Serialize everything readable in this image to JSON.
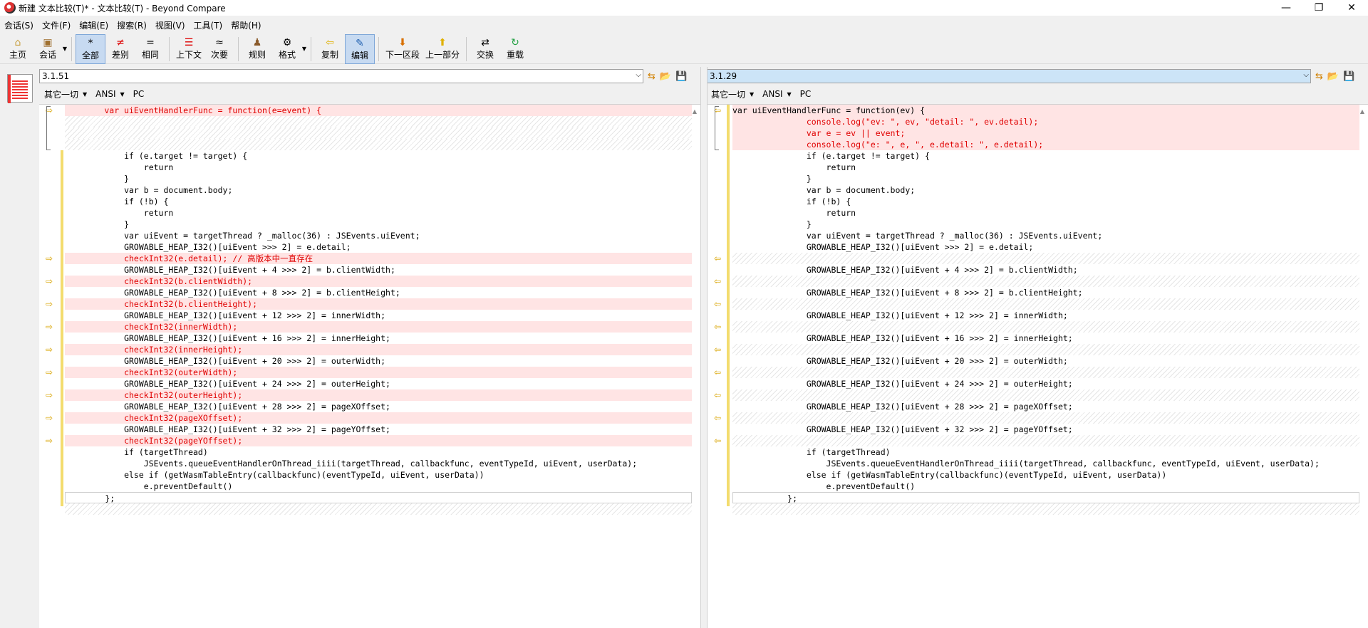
{
  "window": {
    "title": "新建 文本比较(T)* - 文本比较(T) - Beyond Compare",
    "controls": [
      "—",
      "❐",
      "✕"
    ]
  },
  "menu": [
    "会话(S)",
    "文件(F)",
    "编辑(E)",
    "搜索(R)",
    "视图(V)",
    "工具(T)",
    "帮助(H)"
  ],
  "toolbar": [
    {
      "label": "主页",
      "icon": "⌂"
    },
    {
      "label": "会话",
      "icon": "▣"
    },
    {
      "label": "全部",
      "icon": "*"
    },
    {
      "label": "差别",
      "icon": "≠"
    },
    {
      "label": "相同",
      "icon": "="
    },
    {
      "label": "上下文",
      "icon": "☰"
    },
    {
      "label": "次要",
      "icon": "≈"
    },
    {
      "label": "规则",
      "icon": "♟"
    },
    {
      "label": "格式",
      "icon": "⚙"
    },
    {
      "label": "复制",
      "icon": "⇦"
    },
    {
      "label": "编辑",
      "icon": "✎"
    },
    {
      "label": "下一区段",
      "icon": "⬇"
    },
    {
      "label": "上一部分",
      "icon": "⬆"
    },
    {
      "label": "交换",
      "icon": "⇄"
    },
    {
      "label": "重载",
      "icon": "↻"
    }
  ],
  "left": {
    "path": "3.1.51",
    "info": [
      "其它一切",
      "ANSI",
      "PC"
    ],
    "lines": [
      {
        "text": "        var uiEventHandlerFunc = function(e=event) {",
        "type": "diff",
        "mark": "⇨"
      },
      {
        "text": "",
        "type": "hatch"
      },
      {
        "text": "",
        "type": "hatch"
      },
      {
        "text": "",
        "type": "hatch"
      },
      {
        "text": "            if (e.target != target) {",
        "type": "same"
      },
      {
        "text": "                return",
        "type": "same"
      },
      {
        "text": "            }",
        "type": "same"
      },
      {
        "text": "            var b = document.body;",
        "type": "same"
      },
      {
        "text": "            if (!b) {",
        "type": "same"
      },
      {
        "text": "                return",
        "type": "same"
      },
      {
        "text": "            }",
        "type": "same"
      },
      {
        "text": "            var uiEvent = targetThread ? _malloc(36) : JSEvents.uiEvent;",
        "type": "same"
      },
      {
        "text": "            GROWABLE_HEAP_I32()[uiEvent >>> 2] = e.detail;",
        "type": "same"
      },
      {
        "text": "            checkInt32(e.detail); // 高版本中一直存在",
        "type": "diff",
        "mark": "⇨"
      },
      {
        "text": "            GROWABLE_HEAP_I32()[uiEvent + 4 >>> 2] = b.clientWidth;",
        "type": "same"
      },
      {
        "text": "            checkInt32(b.clientWidth);",
        "type": "diff",
        "mark": "⇨"
      },
      {
        "text": "            GROWABLE_HEAP_I32()[uiEvent + 8 >>> 2] = b.clientHeight;",
        "type": "same"
      },
      {
        "text": "            checkInt32(b.clientHeight);",
        "type": "diff",
        "mark": "⇨"
      },
      {
        "text": "            GROWABLE_HEAP_I32()[uiEvent + 12 >>> 2] = innerWidth;",
        "type": "same"
      },
      {
        "text": "            checkInt32(innerWidth);",
        "type": "diff",
        "mark": "⇨"
      },
      {
        "text": "            GROWABLE_HEAP_I32()[uiEvent + 16 >>> 2] = innerHeight;",
        "type": "same"
      },
      {
        "text": "            checkInt32(innerHeight);",
        "type": "diff",
        "mark": "⇨"
      },
      {
        "text": "            GROWABLE_HEAP_I32()[uiEvent + 20 >>> 2] = outerWidth;",
        "type": "same"
      },
      {
        "text": "            checkInt32(outerWidth);",
        "type": "diff",
        "mark": "⇨"
      },
      {
        "text": "            GROWABLE_HEAP_I32()[uiEvent + 24 >>> 2] = outerHeight;",
        "type": "same"
      },
      {
        "text": "            checkInt32(outerHeight);",
        "type": "diff",
        "mark": "⇨"
      },
      {
        "text": "            GROWABLE_HEAP_I32()[uiEvent + 28 >>> 2] = pageXOffset;",
        "type": "same"
      },
      {
        "text": "            checkInt32(pageXOffset);",
        "type": "diff",
        "mark": "⇨"
      },
      {
        "text": "            GROWABLE_HEAP_I32()[uiEvent + 32 >>> 2] = pageYOffset;",
        "type": "same"
      },
      {
        "text": "            checkInt32(pageYOffset);",
        "type": "diff",
        "mark": "⇨"
      },
      {
        "text": "            if (targetThread)",
        "type": "same"
      },
      {
        "text": "                JSEvents.queueEventHandlerOnThread_iiii(targetThread, callbackfunc, eventTypeId, uiEvent, userData);",
        "type": "same"
      },
      {
        "text": "            else if (getWasmTableEntry(callbackfunc)(eventTypeId, uiEvent, userData))",
        "type": "same"
      },
      {
        "text": "                e.preventDefault()",
        "type": "same"
      },
      {
        "text": "        };",
        "type": "end"
      },
      {
        "text": "",
        "type": "hatch"
      }
    ]
  },
  "right": {
    "path": "3.1.29",
    "info": [
      "其它一切",
      "ANSI",
      "PC"
    ],
    "lines": [
      {
        "text": "var uiEventHandlerFunc = function(ev) {",
        "type": "diff-plain",
        "mark": "⇦"
      },
      {
        "text": "               console.log(\"ev: \", ev, \"detail: \", ev.detail);",
        "type": "diff"
      },
      {
        "text": "               var e = ev || event;",
        "type": "diff"
      },
      {
        "text": "               console.log(\"e: \", e, \", e.detail: \", e.detail);",
        "type": "diff"
      },
      {
        "text": "               if (e.target != target) {",
        "type": "same"
      },
      {
        "text": "                   return",
        "type": "same"
      },
      {
        "text": "               }",
        "type": "same"
      },
      {
        "text": "               var b = document.body;",
        "type": "same"
      },
      {
        "text": "               if (!b) {",
        "type": "same"
      },
      {
        "text": "                   return",
        "type": "same"
      },
      {
        "text": "               }",
        "type": "same"
      },
      {
        "text": "               var uiEvent = targetThread ? _malloc(36) : JSEvents.uiEvent;",
        "type": "same"
      },
      {
        "text": "               GROWABLE_HEAP_I32()[uiEvent >>> 2] = e.detail;",
        "type": "same"
      },
      {
        "text": "",
        "type": "hatch",
        "mark": "⇦"
      },
      {
        "text": "               GROWABLE_HEAP_I32()[uiEvent + 4 >>> 2] = b.clientWidth;",
        "type": "same"
      },
      {
        "text": "",
        "type": "hatch",
        "mark": "⇦"
      },
      {
        "text": "               GROWABLE_HEAP_I32()[uiEvent + 8 >>> 2] = b.clientHeight;",
        "type": "same"
      },
      {
        "text": "",
        "type": "hatch",
        "mark": "⇦"
      },
      {
        "text": "               GROWABLE_HEAP_I32()[uiEvent + 12 >>> 2] = innerWidth;",
        "type": "same"
      },
      {
        "text": "",
        "type": "hatch",
        "mark": "⇦"
      },
      {
        "text": "               GROWABLE_HEAP_I32()[uiEvent + 16 >>> 2] = innerHeight;",
        "type": "same"
      },
      {
        "text": "",
        "type": "hatch",
        "mark": "⇦"
      },
      {
        "text": "               GROWABLE_HEAP_I32()[uiEvent + 20 >>> 2] = outerWidth;",
        "type": "same"
      },
      {
        "text": "",
        "type": "hatch",
        "mark": "⇦"
      },
      {
        "text": "               GROWABLE_HEAP_I32()[uiEvent + 24 >>> 2] = outerHeight;",
        "type": "same"
      },
      {
        "text": "",
        "type": "hatch",
        "mark": "⇦"
      },
      {
        "text": "               GROWABLE_HEAP_I32()[uiEvent + 28 >>> 2] = pageXOffset;",
        "type": "same"
      },
      {
        "text": "",
        "type": "hatch",
        "mark": "⇦"
      },
      {
        "text": "               GROWABLE_HEAP_I32()[uiEvent + 32 >>> 2] = pageYOffset;",
        "type": "same"
      },
      {
        "text": "",
        "type": "hatch",
        "mark": "⇦"
      },
      {
        "text": "               if (targetThread)",
        "type": "same"
      },
      {
        "text": "                   JSEvents.queueEventHandlerOnThread_iiii(targetThread, callbackfunc, eventTypeId, uiEvent, userData);",
        "type": "same"
      },
      {
        "text": "               else if (getWasmTableEntry(callbackfunc)(eventTypeId, uiEvent, userData))",
        "type": "same"
      },
      {
        "text": "                   e.preventDefault()",
        "type": "same"
      },
      {
        "text": "           };",
        "type": "end"
      },
      {
        "text": "",
        "type": "hatch"
      }
    ]
  }
}
